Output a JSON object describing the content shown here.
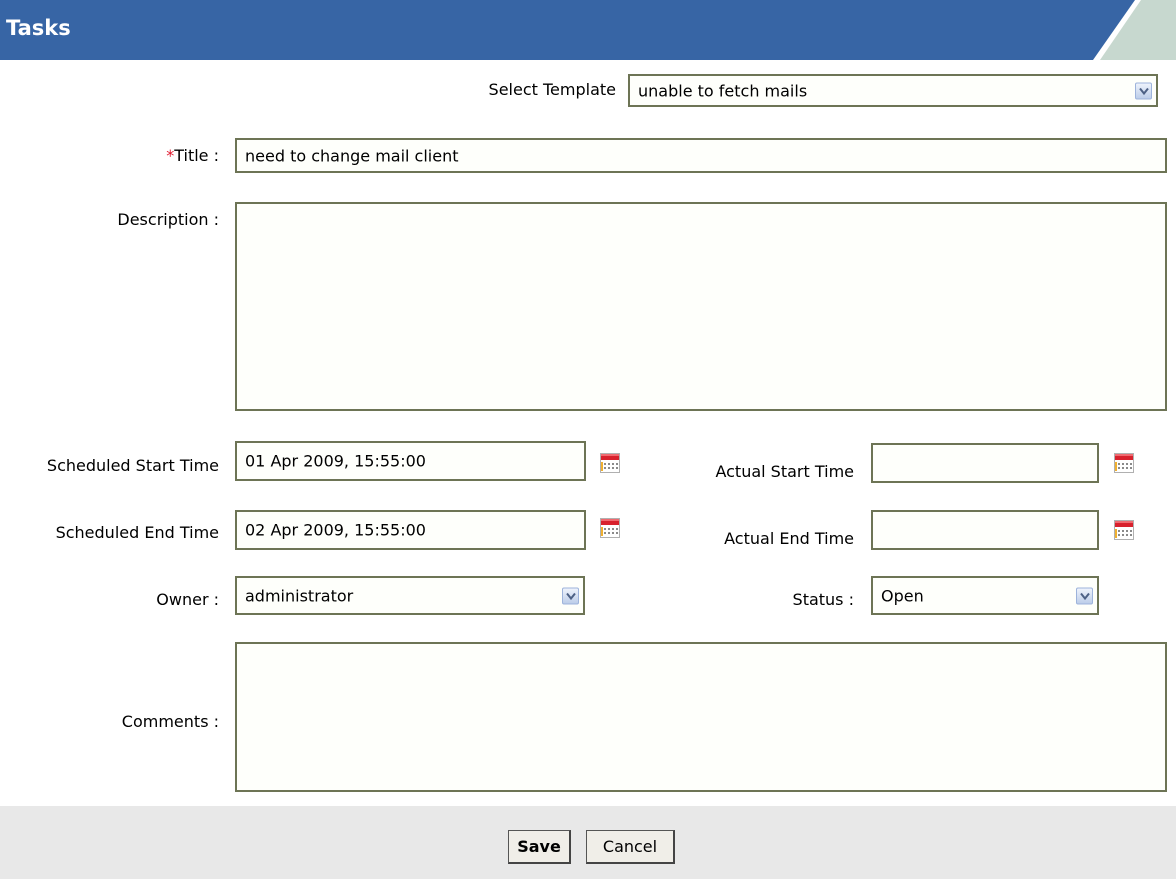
{
  "header": {
    "title": "Tasks"
  },
  "form": {
    "template": {
      "label": "Select Template",
      "value": "unable to fetch mails"
    },
    "title": {
      "required_mark": "*",
      "label": "Title :",
      "value": "need to change mail client"
    },
    "description": {
      "label": "Description :",
      "value": ""
    },
    "scheduled_start": {
      "label": "Scheduled Start Time",
      "value": "01 Apr 2009, 15:55:00"
    },
    "actual_start": {
      "label": "Actual Start Time",
      "value": ""
    },
    "scheduled_end": {
      "label": "Scheduled End Time",
      "value": "02 Apr 2009, 15:55:00"
    },
    "actual_end": {
      "label": "Actual End Time",
      "value": ""
    },
    "owner": {
      "label": "Owner :",
      "value": "administrator"
    },
    "status": {
      "label": "Status :",
      "value": "Open"
    },
    "comments": {
      "label": "Comments :",
      "value": ""
    }
  },
  "buttons": {
    "save_label": "Save",
    "cancel_label": "Cancel"
  },
  "colors": {
    "header_blue": "#3765a5",
    "header_accent": "#c7d8cf",
    "field_border": "#6d7455",
    "required": "#e0162b",
    "footer_bg": "#e8e8e8"
  },
  "icons": {
    "calendar": "calendar-icon",
    "dropdown": "chevron-down-icon"
  }
}
